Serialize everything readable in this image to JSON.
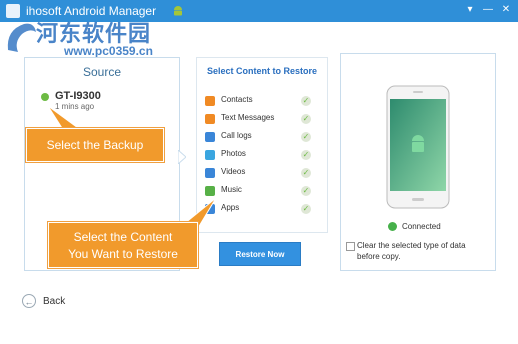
{
  "window": {
    "title": "Jihosoft Android Manager",
    "title_visible": "ihosoft Android Manager",
    "controls": [
      "▾",
      "—",
      "✕"
    ]
  },
  "watermark": {
    "chinese": "河东软件园",
    "url": "www.pc0359.cn"
  },
  "source": {
    "title": "Source",
    "device_name": "GT-I9300",
    "device_time": "1 mins ago"
  },
  "callouts": {
    "select_backup": "Select the Backup",
    "select_content_line1": "Select the Content",
    "select_content_line2": "You Want to Restore"
  },
  "content": {
    "title": "Select Content to Restore",
    "items": [
      {
        "label": "Contacts",
        "icon": "contacts-icon",
        "color": "#f08a24"
      },
      {
        "label": "Text Messages",
        "icon": "messages-icon",
        "color": "#f08a24"
      },
      {
        "label": "Call logs",
        "icon": "call-logs-icon",
        "color": "#3a86d8"
      },
      {
        "label": "Photos",
        "icon": "photos-icon",
        "color": "#3aa6e0"
      },
      {
        "label": "Videos",
        "icon": "videos-icon",
        "color": "#3a86d8"
      },
      {
        "label": "Music",
        "icon": "music-icon",
        "color": "#57b047"
      },
      {
        "label": "Apps",
        "icon": "apps-icon",
        "color": "#3a86d8"
      }
    ],
    "restore_button": "Restore Now"
  },
  "device": {
    "status": "Connected",
    "clear_option": "Clear the selected type of data before copy."
  },
  "footer": {
    "back_label": "Back"
  },
  "colors": {
    "titlebar": "#2f8fd8",
    "accent": "#3391e0",
    "callout": "#f19a2c",
    "connected": "#46b04a"
  }
}
